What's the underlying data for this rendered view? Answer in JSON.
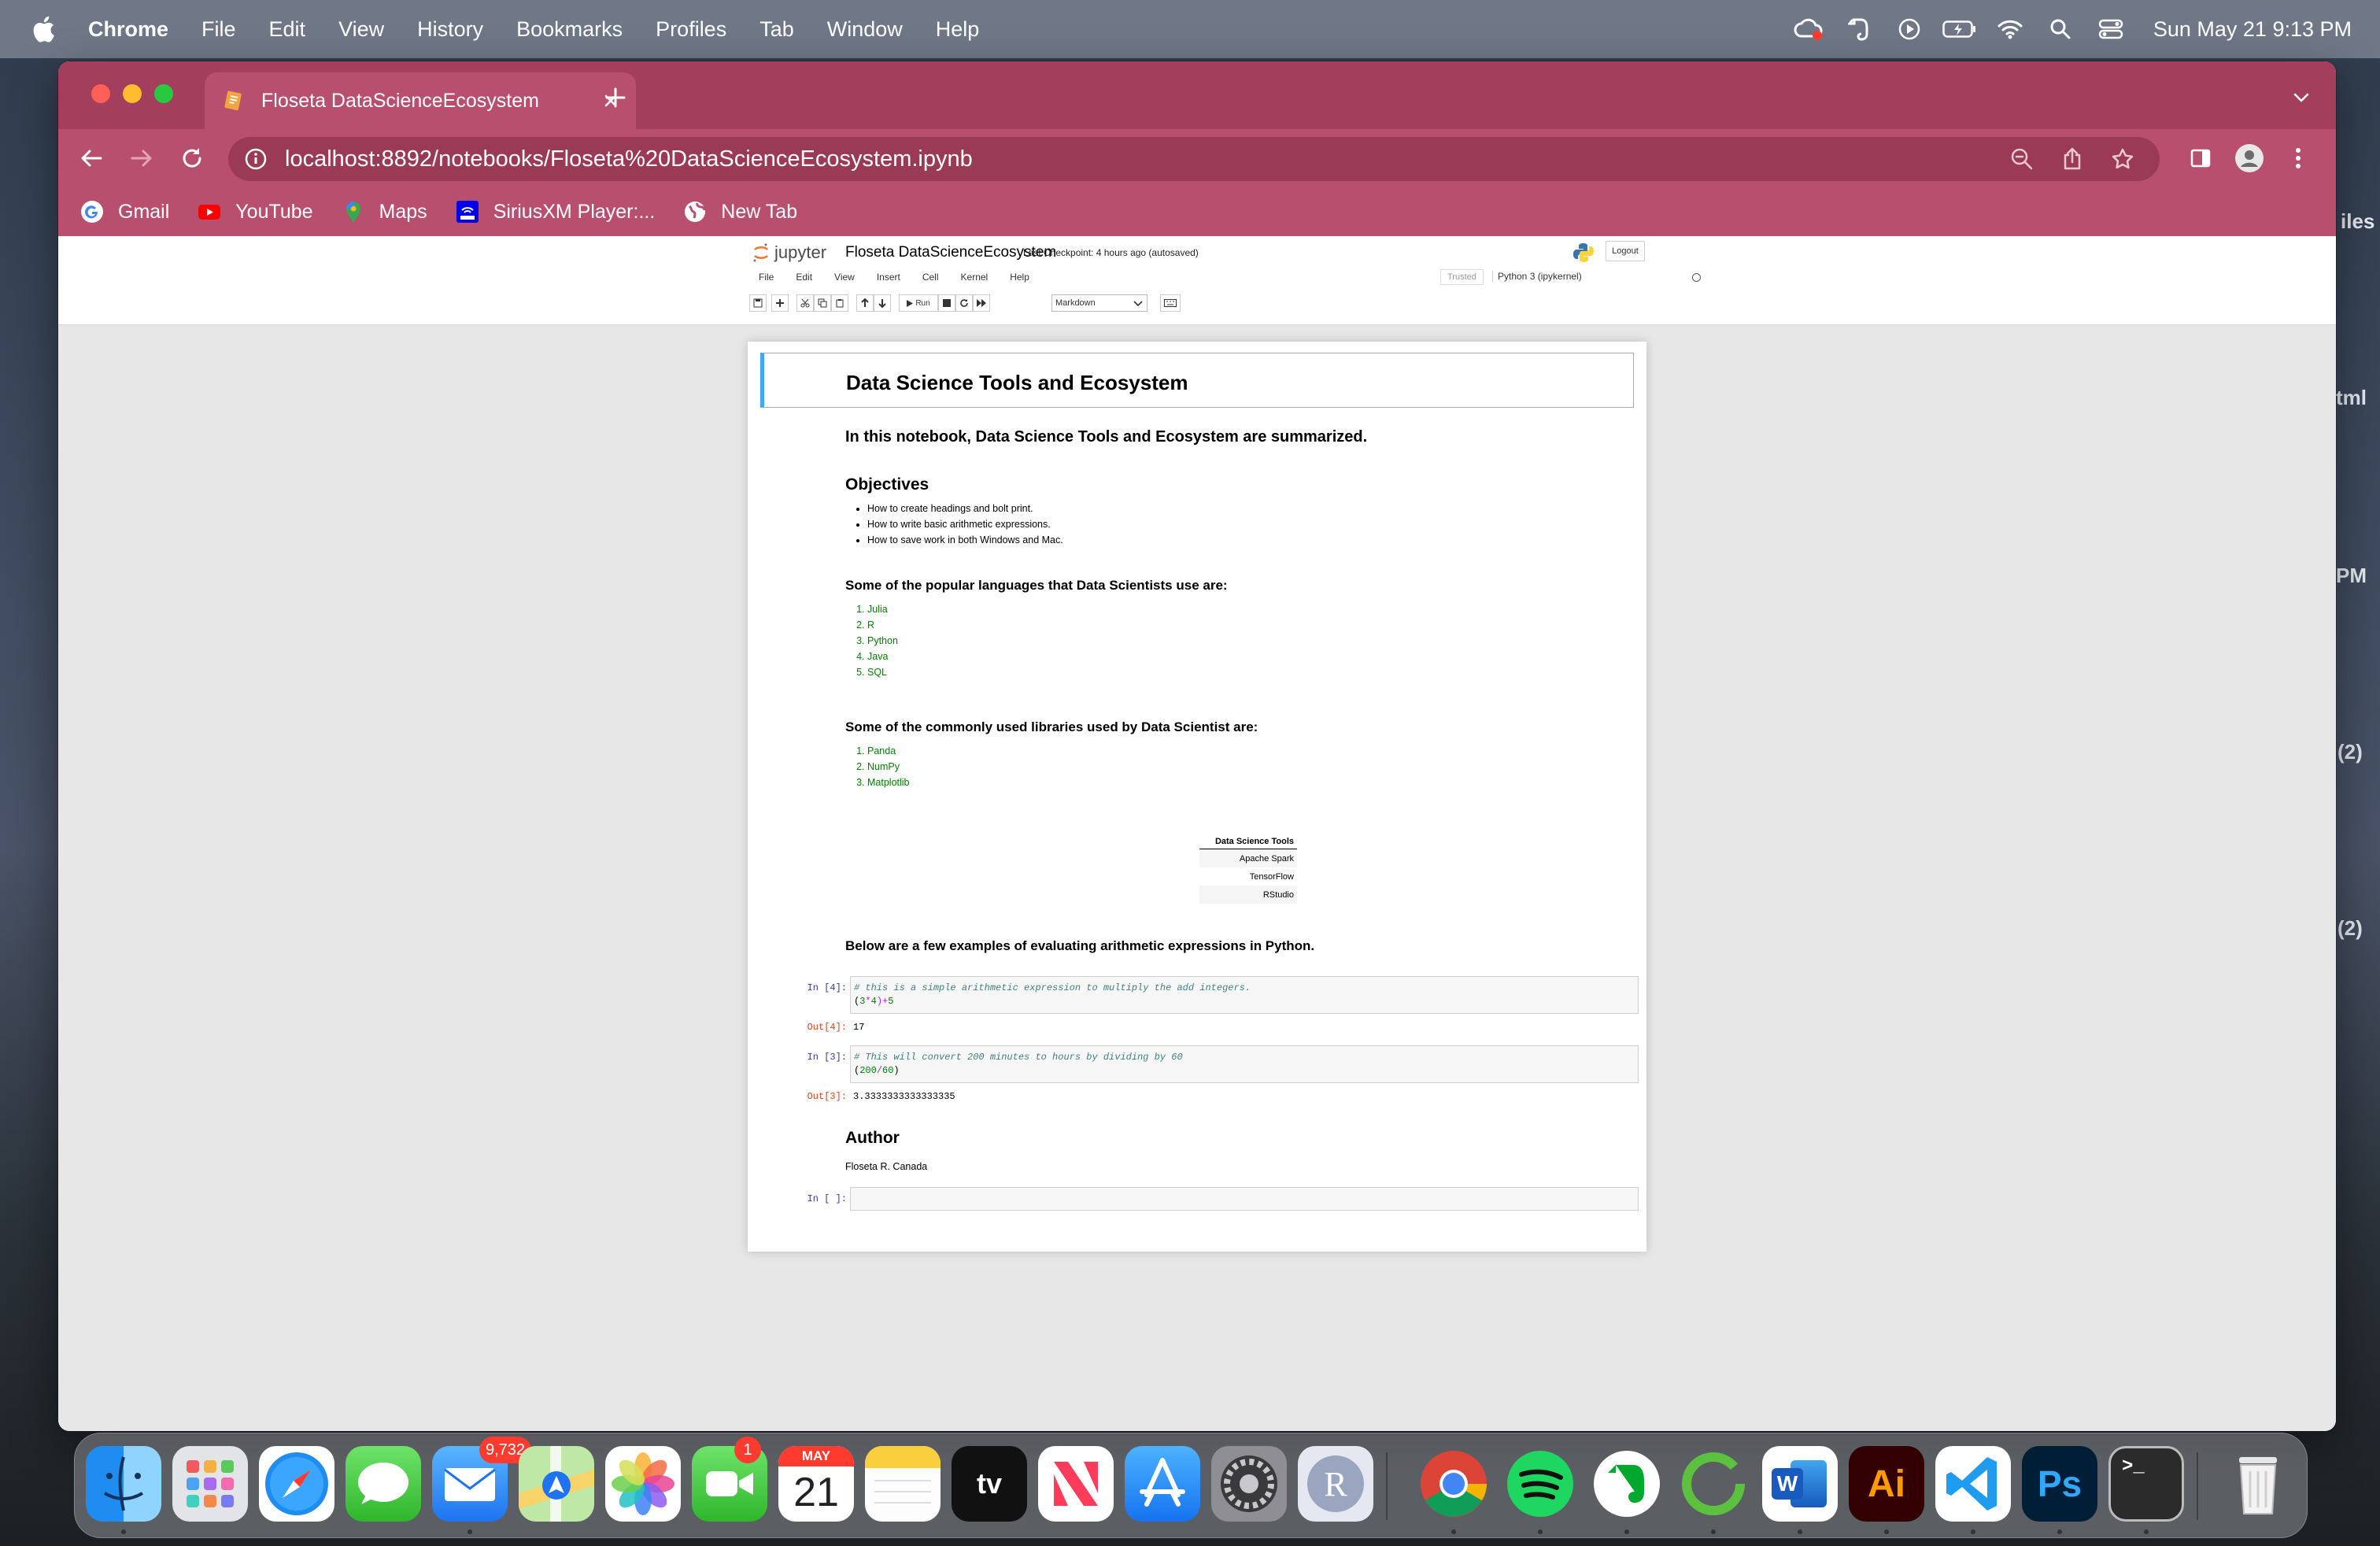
{
  "menubar": {
    "app_name": "Chrome",
    "items": [
      "File",
      "Edit",
      "View",
      "History",
      "Bookmarks",
      "Profiles",
      "Tab",
      "Window",
      "Help"
    ],
    "clock": "Sun May 21  9:13 PM"
  },
  "desktop_side": [
    "iles",
    "tml",
    "PM",
    "(2)",
    "(2)"
  ],
  "browser": {
    "tab_title": "Floseta DataScienceEcosystem",
    "url": "localhost:8892/notebooks/Floseta%20DataScienceEcosystem.ipynb",
    "bookmarks": [
      "Gmail",
      "YouTube",
      "Maps",
      "SiriusXM Player:...",
      "New Tab"
    ]
  },
  "jupyter": {
    "logo_text": "jupyter",
    "notebook_title": "Floseta DataScienceEcosystem",
    "checkpoint": "Last Checkpoint: 4 hours ago  (autosaved)",
    "logout": "Logout",
    "menu": [
      "File",
      "Edit",
      "View",
      "Insert",
      "Cell",
      "Kernel",
      "Help"
    ],
    "trusted": "Trusted",
    "kernel": "Python 3 (ipykernel)",
    "run_label": "Run",
    "cell_type": "Markdown"
  },
  "notebook": {
    "title": "Data Science Tools and Ecosystem",
    "intro": "In this notebook, Data Science Tools and Ecosystem are summarized.",
    "objectives_heading": "Objectives",
    "objectives": [
      "How to create headings and bolt print.",
      "How to write basic arithmetic expressions.",
      "How to save work in both Windows and Mac."
    ],
    "languages_heading": "Some of the popular languages that Data Scientists use are:",
    "languages": [
      "Julia",
      "R",
      "Python",
      "Java",
      "SQL"
    ],
    "libraries_heading": "Some of the commonly used libraries used by Data Scientist are:",
    "libraries": [
      "Panda",
      "NumPy",
      "Matplotlib"
    ],
    "tools_table": {
      "header": "Data Science Tools",
      "rows": [
        "Apache Spark",
        "TensorFlow",
        "RStudio"
      ]
    },
    "examples_heading": "Below are a few examples of evaluating arithmetic expressions in Python.",
    "cells": [
      {
        "in_prompt": "In [4]:",
        "comment": "# this is a simple arithmetic expression to multiply the add integers.",
        "code": [
          "(",
          "3",
          "*",
          "4",
          ")+",
          "5"
        ],
        "out_prompt": "Out[4]:",
        "output": "17"
      },
      {
        "in_prompt": "In [3]:",
        "comment": "# This will convert 200 minutes to hours by dividing by 60",
        "code": [
          "(",
          "200",
          "/",
          "60",
          ")"
        ],
        "out_prompt": "Out[3]:",
        "output": "3.3333333333333335"
      }
    ],
    "author_heading": "Author",
    "author": "Floseta R. Canada",
    "empty_prompt": "In [ ]:"
  },
  "dock": {
    "mail_badge": "9,732",
    "facetime_badge": "1",
    "calendar_month": "MAY",
    "calendar_day": "21",
    "tv_label": "tv",
    "word_label": "W",
    "illustrator_label": "Ai",
    "photoshop_label": "Ps",
    "r_label": "R",
    "terminal_label": ">_"
  },
  "colors": {
    "tab_strip": "#a33e5c",
    "toolbar": "#b84f6e",
    "cell_selected": "#42a5f5"
  }
}
